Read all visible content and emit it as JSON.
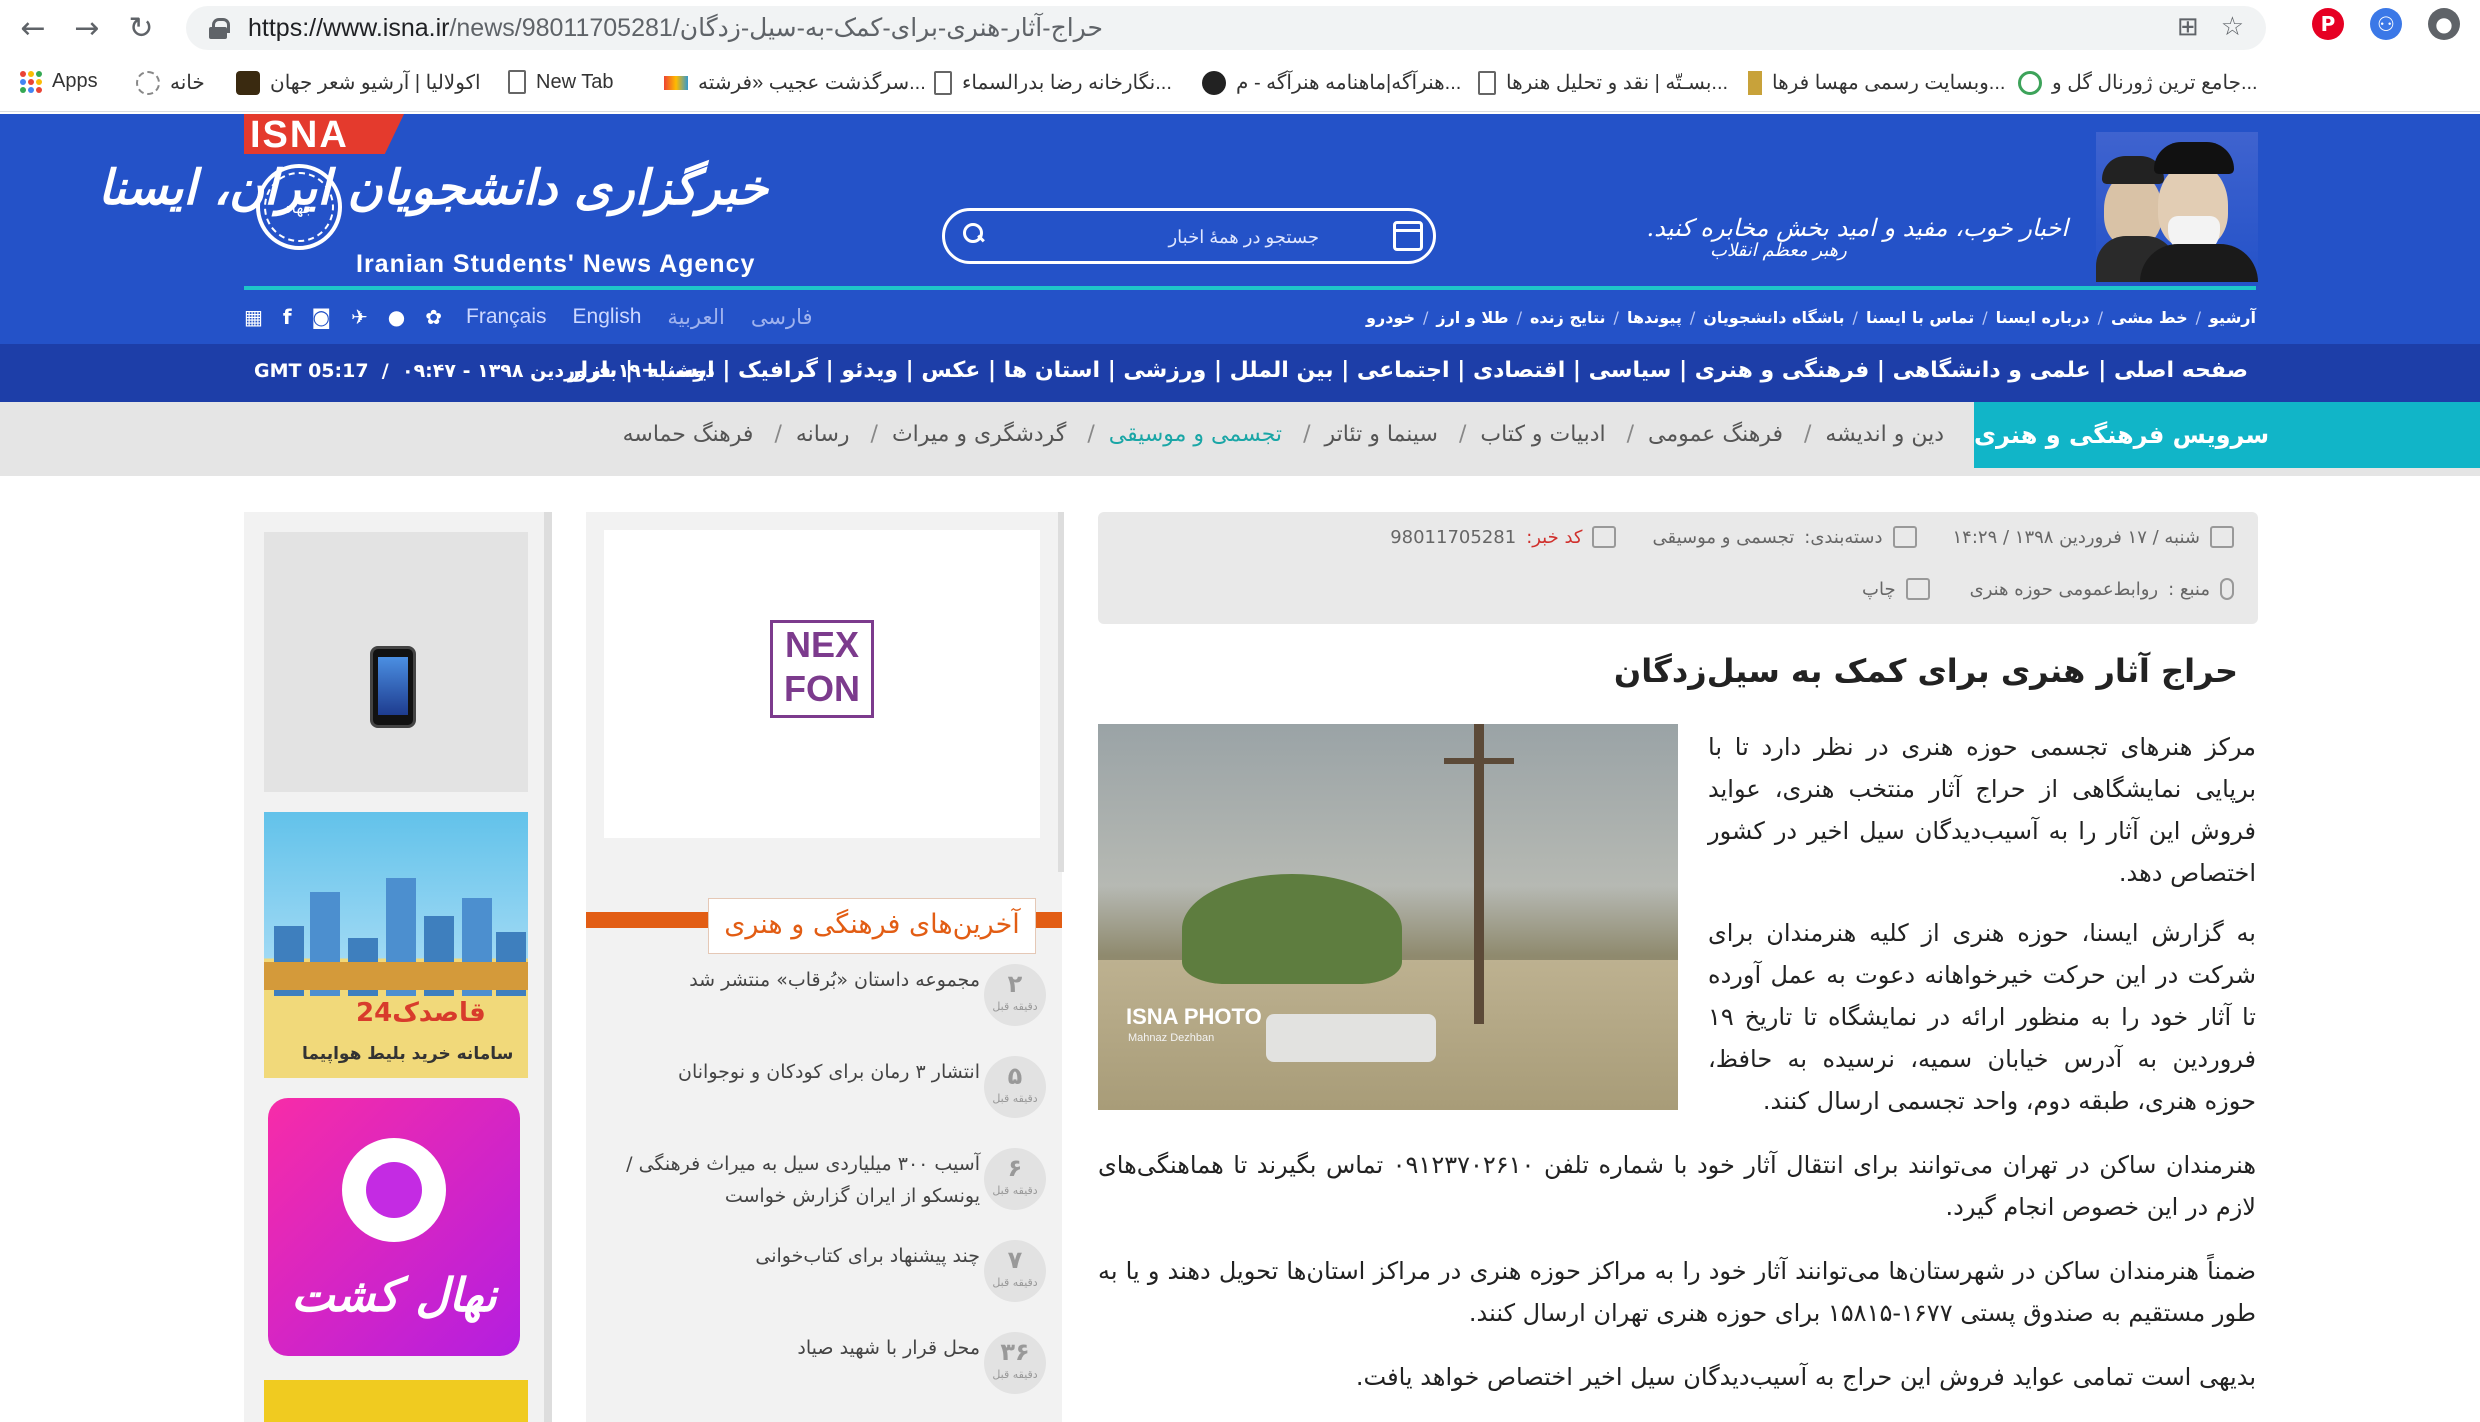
{
  "browser": {
    "url_host": "https://www.isna.ir",
    "url_path": "/news/98011705281/حراج-آثار-هنری-برای-کمک-به-سیل-زدگان",
    "bookmarks": [
      {
        "label": "Apps"
      },
      {
        "label": "خانه"
      },
      {
        "label": "اکولالیا | آرشیو شعر جهان"
      },
      {
        "label": "New Tab"
      },
      {
        "label": "سرگذشت عجیب «فرشته..."
      },
      {
        "label": "نگارخانه رضا بدرالسماء..."
      },
      {
        "label": "هنرآگه|ماهنامه هنرآگه - م..."
      },
      {
        "label": "بسـتّه | نقد و تحلیل هنرها..."
      },
      {
        "label": "وبسایت رسمی مهسا فرها..."
      },
      {
        "label": "جامع ترین ژورنال گل و..."
      }
    ]
  },
  "header": {
    "isna_tab": "ISNA",
    "logo_text_fa": "خبرگزاری دانشجویان ایران، ایسنا",
    "logo_text_en": "Iranian Students' News Agency",
    "logo_seal": "جهاد",
    "search_placeholder": "جستجو در همهٔ اخبار",
    "leader_quote": "اخبار خوب، مفید و امید بخش مخابره کنید.",
    "leader_sub": "رهبر معظم انقلاب",
    "languages": [
      "فارسی",
      "العربية",
      "English",
      "Français"
    ],
    "top_links": [
      "آرشیو",
      "خط مشی",
      "درباره ایسنا",
      "تماس با ایسنا",
      "باشگاه دانشجویان",
      "پیوندها",
      "نتایج زنده",
      "طلا و ارز",
      "خودرو"
    ]
  },
  "main_nav": {
    "items": [
      "صفحه اصلی",
      "علمی و دانشگاهی",
      "فرهنگی و هنری",
      "سیاسی",
      "اقتصادی",
      "اجتماعی",
      "بین الملل",
      "ورزشی",
      "استان ها",
      "عکس",
      "ویدئو",
      "گرافیک",
      "ایسنا+",
      "بازار"
    ],
    "date": "دوشنبه ۱۹ فروردین ۱۳۹۸ - ۰۹:۴۷",
    "gmt": "GMT 05:17"
  },
  "service": {
    "title": "سرویس فرهنگی و هنری",
    "items": [
      "دین و اندیشه",
      "فرهنگ عمومی",
      "ادبیات و کتاب",
      "سینما و تئاتر",
      "تجسمی و موسیقی",
      "گردشگری و میراث",
      "رسانه",
      "فرهنگ حماسه"
    ],
    "active_index": 4
  },
  "sidebar_ads": {
    "flight_brand": "قاصدک24",
    "flight_text": "سامانه خرید بلیط هواپیما",
    "nahal_text": "نهال کشت"
  },
  "mid_ad": {
    "brand_line1": "NEX",
    "brand_line2": "FON"
  },
  "latest": {
    "title": "آخرین‌های فرهنگی و هنری",
    "unit": "دقیقه قبل",
    "items": [
      {
        "minutes": "۲",
        "text": "مجموعه داستان «بُرقاب» منتشر شد"
      },
      {
        "minutes": "۵",
        "text": "انتشار ۳ رمان برای کودکان و نوجوانان"
      },
      {
        "minutes": "۶",
        "text": "آسیب ۳۰۰ میلیاردی سیل به میراث فرهنگی /یونسکو از ایران گزارش خواست"
      },
      {
        "minutes": "۷",
        "text": "چند پیشنهاد برای کتاب‌خوانی"
      },
      {
        "minutes": "۳۶",
        "text": "محل قرار با شهید صیاد"
      }
    ]
  },
  "article": {
    "meta_date": "شنبه / ۱۷ فروردین ۱۳۹۸ / ۱۴:۲۹",
    "meta_category_label": "دسته‌بندی:",
    "meta_category": "تجسمی و موسیقی",
    "meta_code_label": "کد خبر:",
    "meta_code": "98011705281",
    "meta_source_label": "منبع :",
    "meta_source": "روابط‌عمومی حوزه هنری",
    "meta_print": "چاپ",
    "title": "حراج آثار هنری برای کمک به سیل‌زدگان",
    "photo_label": "ISNA PHOTO",
    "photo_credit": "Mahnaz Dezhban",
    "paragraphs": [
      "مرکز هنرهای تجسمی حوزه هنری در نظر دارد تا با برپایی نمایشگاهی از حراج آثار منتخب هنری، عواید فروش این آثار را به آسیب‌دیدگان سیل اخیر در کشور اختصاص دهد.",
      "به گزارش ایسنا، حوزه هنری از کلیه هنرمندان برای شرکت در این حرکت خیرخواهانه دعوت به عمل آورده تا آثار خود را به منظور ارائه در نمایشگاه تا تاریخ ۱۹ فروردین به آدرس خیابان سمیه، نرسیده به حافظ، حوزه هنری، طبقه دوم، واحد تجسمی ارسال کنند.",
      "هنرمندان ساکن در تهران می‌توانند برای انتقال آثار خود با شماره تلفن ۰۹۱۲۳۷۰۲۶۱۰ تماس بگیرند تا هماهنگی‌های لازم در این خصوص انجام گیرد.",
      "ضمناً هنرمندان ساکن در شهرستان‌ها می‌توانند آثار خود را به مراکز حوزه هنری در مراکز استان‌ها تحویل دهند و یا به طور مستقیم به صندوق پستی ۱۶۷۷-۱۵۸۱۵ برای حوزه هنری تهران ارسال کنند.",
      "بدیهی است تمامی عواید فروش این حراج به آسیب‌دیدگان سیل اخیر اختصاص خواهد یافت."
    ]
  },
  "colors": {
    "header_blue": "#2452c8",
    "nav_blue": "#1d3ea8",
    "teal": "#11b5c8",
    "orange": "#e25d14",
    "red": "#e43a2d"
  }
}
